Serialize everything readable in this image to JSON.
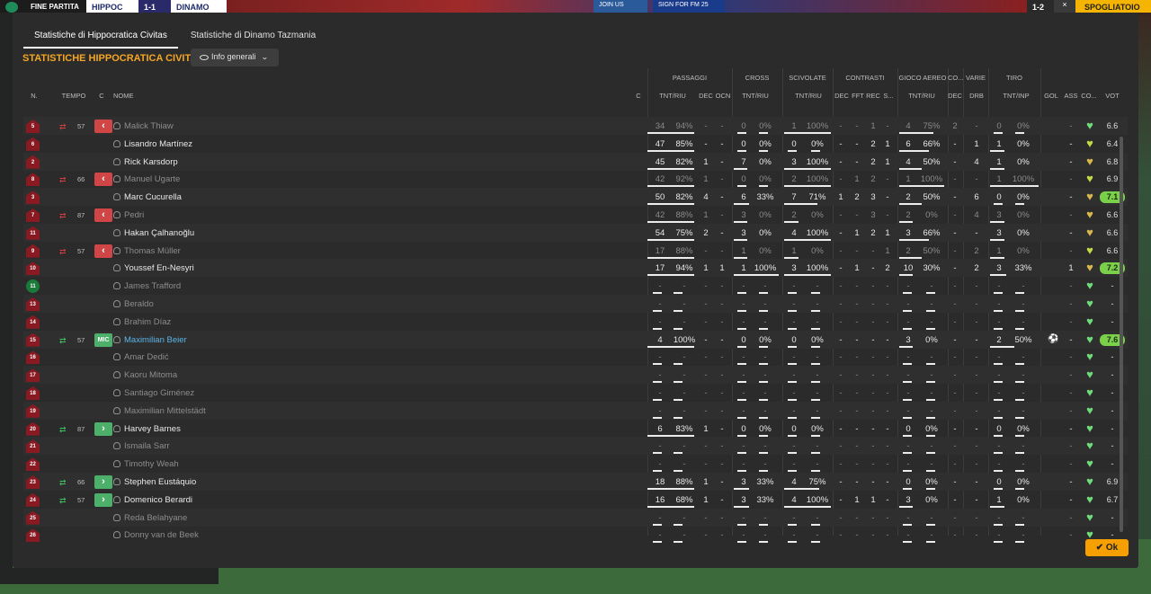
{
  "topbar": {
    "match_status": "FINE PARTITA",
    "home": "HIPPOC",
    "score": "1-1",
    "away": "DINAMO",
    "ad1": "JOIN US",
    "ad2": "SIGN FOR FM 25",
    "mini_score": "1-2",
    "close": "×",
    "next": "SPOGLIATOIO"
  },
  "tabs": [
    "Statistiche di Hippocratica Civitas",
    "Statistiche di Dinamo Tazmania"
  ],
  "heading": "STATISTICHE HIPPOCRATICA CIVITAS",
  "dropdown": "Info generali",
  "groups": [
    "PASSAGGI",
    "CROSS",
    "SCIVOLATE",
    "CONTRASTI",
    "GIOCO AEREO",
    "CO...",
    "VARIE",
    "TIRO"
  ],
  "columns": {
    "n": "N.",
    "tempo": "TEMPO",
    "c": "C",
    "nome": "NOME",
    "c2": "C",
    "pass": "TNT/RIU",
    "pass_dec": "DEC",
    "pass_ocn": "OCN",
    "cross": "TNT/RIU",
    "sciv": "TNT/RIU",
    "con_dec": "DEC",
    "con_fft": "FFT",
    "con_rec": "REC",
    "con_s": "S...",
    "aereo": "TNT/RIU",
    "co_dec": "DEC",
    "drb": "DRB",
    "tiro": "TNT/INP",
    "gol": "GOL",
    "ass": "ASS",
    "cond": "CO...",
    "vot": "VOT"
  },
  "rows": [
    {
      "n": "5",
      "icon": "out",
      "min": "57",
      "cap": "out",
      "name": "Malick Thiaw",
      "dim": true,
      "p": [
        "34",
        "94%"
      ],
      "pd": "-",
      "po": "-",
      "cr": [
        "0",
        "0%"
      ],
      "sc": [
        "1",
        "100%"
      ],
      "ct": [
        "-",
        "-",
        "1",
        "-"
      ],
      "ae": [
        "4",
        "75%"
      ],
      "cd": "2",
      "dr": "-",
      "ti": [
        "0",
        "0%"
      ],
      "gol": "",
      "ass": "-",
      "heart": "#6fdc7a",
      "vot": "6.6",
      "green": false
    },
    {
      "n": "6",
      "icon": "",
      "min": "",
      "cap": "",
      "name": "Lisandro Martínez",
      "dim": false,
      "p": [
        "47",
        "85%"
      ],
      "pd": "-",
      "po": "-",
      "cr": [
        "0",
        "0%"
      ],
      "sc": [
        "0",
        "0%"
      ],
      "ct": [
        "-",
        "-",
        "2",
        "1"
      ],
      "ae": [
        "6",
        "66%"
      ],
      "cd": "-",
      "dr": "1",
      "ti": [
        "1",
        "0%"
      ],
      "gol": "",
      "ass": "-",
      "heart": "#c5d84a",
      "vot": "6.4",
      "green": false
    },
    {
      "n": "2",
      "icon": "",
      "min": "",
      "cap": "",
      "name": "Rick Karsdorp",
      "dim": false,
      "p": [
        "45",
        "82%"
      ],
      "pd": "1",
      "po": "-",
      "cr": [
        "7",
        "0%"
      ],
      "sc": [
        "3",
        "100%"
      ],
      "ct": [
        "-",
        "-",
        "2",
        "1"
      ],
      "ae": [
        "4",
        "50%"
      ],
      "cd": "-",
      "dr": "4",
      "ti": [
        "1",
        "0%"
      ],
      "gol": "",
      "ass": "-",
      "heart": "#d8b84a",
      "vot": "6.8",
      "green": false
    },
    {
      "n": "8",
      "icon": "out",
      "min": "66",
      "cap": "out",
      "name": "Manuel Ugarte",
      "dim": true,
      "p": [
        "42",
        "92%"
      ],
      "pd": "1",
      "po": "-",
      "cr": [
        "0",
        "0%"
      ],
      "sc": [
        "2",
        "100%"
      ],
      "ct": [
        "-",
        "1",
        "2",
        "-"
      ],
      "ae": [
        "1",
        "100%"
      ],
      "cd": "-",
      "dr": "-",
      "ti": [
        "1",
        "100%"
      ],
      "gol": "",
      "ass": "-",
      "heart": "#c5d84a",
      "vot": "6.9",
      "green": false
    },
    {
      "n": "3",
      "icon": "",
      "min": "",
      "cap": "",
      "name": "Marc Cucurella",
      "dim": false,
      "p": [
        "50",
        "82%"
      ],
      "pd": "4",
      "po": "-",
      "cr": [
        "6",
        "33%"
      ],
      "sc": [
        "7",
        "71%"
      ],
      "ct": [
        "1",
        "2",
        "3",
        "-"
      ],
      "ae": [
        "2",
        "50%"
      ],
      "cd": "-",
      "dr": "6",
      "ti": [
        "0",
        "0%"
      ],
      "gol": "",
      "ass": "-",
      "heart": "#d8b84a",
      "vot": "7.1",
      "green": true
    },
    {
      "n": "7",
      "icon": "out",
      "min": "87",
      "cap": "out",
      "name": "Pedri",
      "dim": true,
      "p": [
        "42",
        "88%"
      ],
      "pd": "1",
      "po": "-",
      "cr": [
        "3",
        "0%"
      ],
      "sc": [
        "2",
        "0%"
      ],
      "ct": [
        "-",
        "-",
        "3",
        "-"
      ],
      "ae": [
        "2",
        "0%"
      ],
      "cd": "-",
      "dr": "4",
      "ti": [
        "3",
        "0%"
      ],
      "gol": "",
      "ass": "-",
      "heart": "#d8b84a",
      "vot": "6.6",
      "green": false
    },
    {
      "n": "11",
      "icon": "",
      "min": "",
      "cap": "",
      "name": "Hakan Çalhanoğlu",
      "dim": false,
      "p": [
        "54",
        "75%"
      ],
      "pd": "2",
      "po": "-",
      "cr": [
        "3",
        "0%"
      ],
      "sc": [
        "4",
        "100%"
      ],
      "ct": [
        "-",
        "1",
        "2",
        "1"
      ],
      "ae": [
        "3",
        "66%"
      ],
      "cd": "-",
      "dr": "-",
      "ti": [
        "3",
        "0%"
      ],
      "gol": "",
      "ass": "-",
      "heart": "#d8b84a",
      "vot": "6.6",
      "green": false
    },
    {
      "n": "9",
      "icon": "out",
      "min": "57",
      "cap": "out",
      "name": "Thomas Müller",
      "dim": true,
      "p": [
        "17",
        "88%"
      ],
      "pd": "-",
      "po": "-",
      "cr": [
        "1",
        "0%"
      ],
      "sc": [
        "1",
        "0%"
      ],
      "ct": [
        "-",
        "-",
        "-",
        "1"
      ],
      "ae": [
        "2",
        "50%"
      ],
      "cd": "-",
      "dr": "2",
      "ti": [
        "1",
        "0%"
      ],
      "gol": "",
      "ass": "-",
      "heart": "#c5d84a",
      "vot": "6.6",
      "green": false
    },
    {
      "n": "10",
      "icon": "",
      "min": "",
      "cap": "",
      "name": "Youssef En-Nesyri",
      "dim": false,
      "p": [
        "17",
        "94%"
      ],
      "pd": "1",
      "po": "1",
      "cr": [
        "1",
        "100%"
      ],
      "sc": [
        "3",
        "100%"
      ],
      "ct": [
        "-",
        "1",
        "-",
        "2"
      ],
      "ae": [
        "10",
        "30%"
      ],
      "cd": "-",
      "dr": "2",
      "ti": [
        "3",
        "33%"
      ],
      "gol": "",
      "ass": "1",
      "heart": "#d8b84a",
      "vot": "7.2",
      "green": true
    },
    {
      "n": "11",
      "gk": true,
      "icon": "",
      "min": "",
      "cap": "",
      "name": "James Trafford",
      "dim": true,
      "p": [
        "-",
        "-"
      ],
      "pd": "-",
      "po": "-",
      "cr": [
        "-",
        "-"
      ],
      "sc": [
        "-",
        "-"
      ],
      "ct": [
        "-",
        "-",
        "-",
        "-"
      ],
      "ae": [
        "-",
        "-"
      ],
      "cd": "-",
      "dr": "-",
      "ti": [
        "-",
        "-"
      ],
      "gol": "",
      "ass": "-",
      "heart": "#6fdc7a",
      "vot": "-",
      "green": false
    },
    {
      "n": "13",
      "icon": "",
      "min": "",
      "cap": "",
      "name": "Beraldo",
      "dim": true,
      "p": [
        "-",
        "-"
      ],
      "pd": "-",
      "po": "-",
      "cr": [
        "-",
        "-"
      ],
      "sc": [
        "-",
        "-"
      ],
      "ct": [
        "-",
        "-",
        "-",
        "-"
      ],
      "ae": [
        "-",
        "-"
      ],
      "cd": "-",
      "dr": "-",
      "ti": [
        "-",
        "-"
      ],
      "gol": "",
      "ass": "-",
      "heart": "#6fdc7a",
      "vot": "-",
      "green": false
    },
    {
      "n": "14",
      "icon": "",
      "min": "",
      "cap": "",
      "name": "Brahim Díaz",
      "dim": true,
      "p": [
        "-",
        "-"
      ],
      "pd": "-",
      "po": "-",
      "cr": [
        "-",
        "-"
      ],
      "sc": [
        "-",
        "-"
      ],
      "ct": [
        "-",
        "-",
        "-",
        "-"
      ],
      "ae": [
        "-",
        "-"
      ],
      "cd": "-",
      "dr": "-",
      "ti": [
        "-",
        "-"
      ],
      "gol": "",
      "ass": "-",
      "heart": "#6fdc7a",
      "vot": "-",
      "green": false
    },
    {
      "n": "15",
      "icon": "in",
      "min": "57",
      "cap": "mic",
      "name": "Maximilian Beier",
      "dim": false,
      "blue": true,
      "p": [
        "4",
        "100%"
      ],
      "pd": "-",
      "po": "-",
      "cr": [
        "0",
        "0%"
      ],
      "sc": [
        "0",
        "0%"
      ],
      "ct": [
        "-",
        "-",
        "-",
        "-"
      ],
      "ae": [
        "3",
        "0%"
      ],
      "cd": "-",
      "dr": "-",
      "ti": [
        "2",
        "50%"
      ],
      "gol": "⚽",
      "ass": "-",
      "heart": "#6fdc7a",
      "vot": "7.6",
      "green": true
    },
    {
      "n": "16",
      "icon": "",
      "min": "",
      "cap": "",
      "name": "Amar Dedić",
      "dim": true,
      "p": [
        "-",
        "-"
      ],
      "pd": "-",
      "po": "-",
      "cr": [
        "-",
        "-"
      ],
      "sc": [
        "-",
        "-"
      ],
      "ct": [
        "-",
        "-",
        "-",
        "-"
      ],
      "ae": [
        "-",
        "-"
      ],
      "cd": "-",
      "dr": "-",
      "ti": [
        "-",
        "-"
      ],
      "gol": "",
      "ass": "-",
      "heart": "#6fdc7a",
      "vot": "-",
      "green": false
    },
    {
      "n": "17",
      "icon": "",
      "min": "",
      "cap": "",
      "name": "Kaoru Mitoma",
      "dim": true,
      "p": [
        "-",
        "-"
      ],
      "pd": "-",
      "po": "-",
      "cr": [
        "-",
        "-"
      ],
      "sc": [
        "-",
        "-"
      ],
      "ct": [
        "-",
        "-",
        "-",
        "-"
      ],
      "ae": [
        "-",
        "-"
      ],
      "cd": "-",
      "dr": "-",
      "ti": [
        "-",
        "-"
      ],
      "gol": "",
      "ass": "-",
      "heart": "#6fdc7a",
      "vot": "-",
      "green": false
    },
    {
      "n": "18",
      "icon": "",
      "min": "",
      "cap": "",
      "name": "Santiago Giménez",
      "dim": true,
      "p": [
        "-",
        "-"
      ],
      "pd": "-",
      "po": "-",
      "cr": [
        "-",
        "-"
      ],
      "sc": [
        "-",
        "-"
      ],
      "ct": [
        "-",
        "-",
        "-",
        "-"
      ],
      "ae": [
        "-",
        "-"
      ],
      "cd": "-",
      "dr": "-",
      "ti": [
        "-",
        "-"
      ],
      "gol": "",
      "ass": "-",
      "heart": "#6fdc7a",
      "vot": "-",
      "green": false
    },
    {
      "n": "19",
      "icon": "",
      "min": "",
      "cap": "",
      "name": "Maximilian Mittelstädt",
      "dim": true,
      "p": [
        "-",
        "-"
      ],
      "pd": "-",
      "po": "-",
      "cr": [
        "-",
        "-"
      ],
      "sc": [
        "-",
        "-"
      ],
      "ct": [
        "-",
        "-",
        "-",
        "-"
      ],
      "ae": [
        "-",
        "-"
      ],
      "cd": "-",
      "dr": "-",
      "ti": [
        "-",
        "-"
      ],
      "gol": "",
      "ass": "-",
      "heart": "#6fdc7a",
      "vot": "-",
      "green": false
    },
    {
      "n": "20",
      "icon": "in",
      "min": "87",
      "cap": "in",
      "name": "Harvey Barnes",
      "dim": false,
      "p": [
        "6",
        "83%"
      ],
      "pd": "1",
      "po": "-",
      "cr": [
        "0",
        "0%"
      ],
      "sc": [
        "0",
        "0%"
      ],
      "ct": [
        "-",
        "-",
        "-",
        "-"
      ],
      "ae": [
        "0",
        "0%"
      ],
      "cd": "-",
      "dr": "-",
      "ti": [
        "0",
        "0%"
      ],
      "gol": "",
      "ass": "-",
      "heart": "#6fdc7a",
      "vot": "-",
      "green": false
    },
    {
      "n": "21",
      "icon": "",
      "min": "",
      "cap": "",
      "name": "Ismaila Sarr",
      "dim": true,
      "p": [
        "-",
        "-"
      ],
      "pd": "-",
      "po": "-",
      "cr": [
        "-",
        "-"
      ],
      "sc": [
        "-",
        "-"
      ],
      "ct": [
        "-",
        "-",
        "-",
        "-"
      ],
      "ae": [
        "-",
        "-"
      ],
      "cd": "-",
      "dr": "-",
      "ti": [
        "-",
        "-"
      ],
      "gol": "",
      "ass": "-",
      "heart": "#6fdc7a",
      "vot": "-",
      "green": false
    },
    {
      "n": "22",
      "icon": "",
      "min": "",
      "cap": "",
      "name": "Timothy Weah",
      "dim": true,
      "p": [
        "-",
        "-"
      ],
      "pd": "-",
      "po": "-",
      "cr": [
        "-",
        "-"
      ],
      "sc": [
        "-",
        "-"
      ],
      "ct": [
        "-",
        "-",
        "-",
        "-"
      ],
      "ae": [
        "-",
        "-"
      ],
      "cd": "-",
      "dr": "-",
      "ti": [
        "-",
        "-"
      ],
      "gol": "",
      "ass": "-",
      "heart": "#6fdc7a",
      "vot": "-",
      "green": false
    },
    {
      "n": "23",
      "icon": "in",
      "min": "66",
      "cap": "in",
      "name": "Stephen Eustáquio",
      "dim": false,
      "p": [
        "18",
        "88%"
      ],
      "pd": "1",
      "po": "-",
      "cr": [
        "3",
        "33%"
      ],
      "sc": [
        "4",
        "75%"
      ],
      "ct": [
        "-",
        "-",
        "-",
        "-"
      ],
      "ae": [
        "0",
        "0%"
      ],
      "cd": "-",
      "dr": "-",
      "ti": [
        "0",
        "0%"
      ],
      "gol": "",
      "ass": "-",
      "heart": "#6fdc7a",
      "vot": "6.9",
      "green": false
    },
    {
      "n": "24",
      "icon": "in",
      "min": "57",
      "cap": "in",
      "name": "Domenico Berardi",
      "dim": false,
      "p": [
        "16",
        "68%"
      ],
      "pd": "1",
      "po": "-",
      "cr": [
        "3",
        "33%"
      ],
      "sc": [
        "4",
        "100%"
      ],
      "ct": [
        "-",
        "1",
        "1",
        "-"
      ],
      "ae": [
        "3",
        "0%"
      ],
      "cd": "-",
      "dr": "-",
      "ti": [
        "1",
        "0%"
      ],
      "gol": "",
      "ass": "-",
      "heart": "#6fdc7a",
      "vot": "6.7",
      "green": false
    },
    {
      "n": "25",
      "icon": "",
      "min": "",
      "cap": "",
      "name": "Reda Belahyane",
      "dim": true,
      "p": [
        "-",
        "-"
      ],
      "pd": "-",
      "po": "-",
      "cr": [
        "-",
        "-"
      ],
      "sc": [
        "-",
        "-"
      ],
      "ct": [
        "-",
        "-",
        "-",
        "-"
      ],
      "ae": [
        "-",
        "-"
      ],
      "cd": "-",
      "dr": "-",
      "ti": [
        "-",
        "-"
      ],
      "gol": "",
      "ass": "-",
      "heart": "#6fdc7a",
      "vot": "-",
      "green": false
    },
    {
      "n": "26",
      "icon": "",
      "min": "",
      "cap": "",
      "name": "Donny van de Beek",
      "dim": true,
      "p": [
        "-",
        "-"
      ],
      "pd": "-",
      "po": "-",
      "cr": [
        "-",
        "-"
      ],
      "sc": [
        "-",
        "-"
      ],
      "ct": [
        "-",
        "-",
        "-",
        "-"
      ],
      "ae": [
        "-",
        "-"
      ],
      "cd": "-",
      "dr": "-",
      "ti": [
        "-",
        "-"
      ],
      "gol": "",
      "ass": "-",
      "heart": "#6fdc7a",
      "vot": "-",
      "green": false
    }
  ],
  "ok_label": "Ok"
}
